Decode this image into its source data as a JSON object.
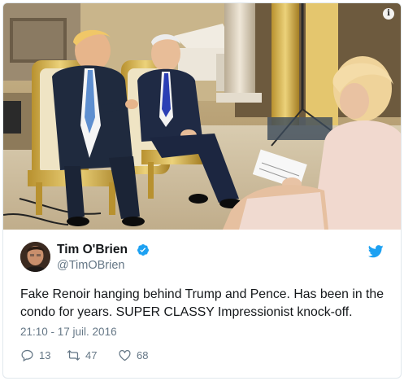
{
  "tweet": {
    "author_name": "Tim O'Brien",
    "handle": "@TimOBrien",
    "text": "Fake Renoir hanging behind Trump and Pence. Has been in the condo for years. SUPER CLASSY Impressionist knock-off.",
    "timestamp": "21:10 - 17 juil. 2016",
    "replies": "13",
    "retweets": "47",
    "likes": "68"
  },
  "media": {
    "info_badge": "i"
  },
  "icons": {
    "verified": "verified-badge-icon",
    "platform": "twitter-bird-icon",
    "reply": "reply-icon",
    "retweet": "retweet-icon",
    "like": "heart-icon"
  },
  "colors": {
    "brand": "#1da1f2",
    "secondary_text": "#657786",
    "primary_text": "#14171a",
    "border": "#e1e8ed"
  }
}
